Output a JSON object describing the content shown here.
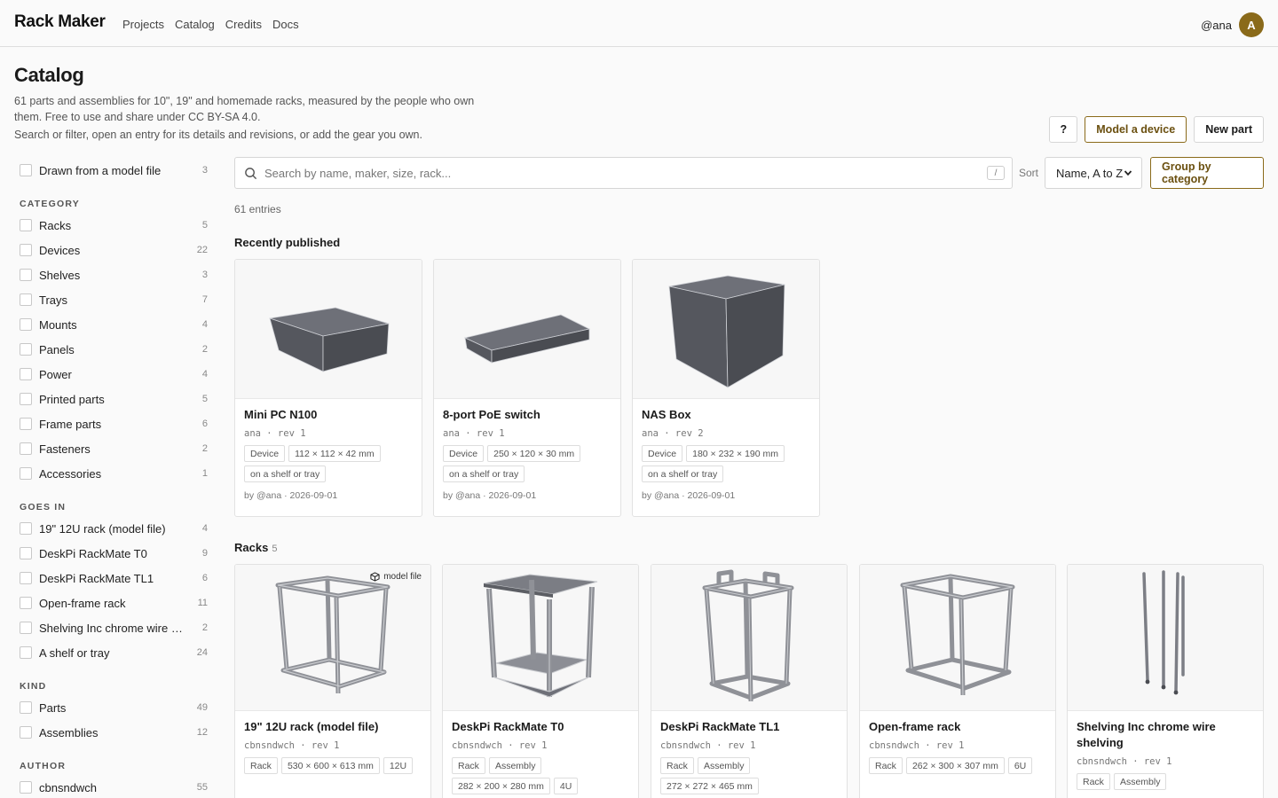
{
  "app": {
    "name": "Rack Maker",
    "nav": [
      "Projects",
      "Catalog",
      "Credits",
      "Docs"
    ],
    "user": "@ana",
    "avatar_initial": "A"
  },
  "header": {
    "title": "Catalog",
    "desc1": "61 parts and assemblies for 10\", 19\" and homemade racks, measured by the people who own them. Free to use and share under CC BY-SA 4.0.",
    "desc2": "Search or filter, open an entry for its details and revisions, or add the gear you own.",
    "help_label": "?",
    "model_device_label": "Model a device",
    "new_part_label": "New part"
  },
  "filters": {
    "model_file": {
      "label": "Drawn from a model file",
      "count": "3"
    },
    "category": {
      "heading": "CATEGORY",
      "items": [
        {
          "label": "Racks",
          "count": "5"
        },
        {
          "label": "Devices",
          "count": "22"
        },
        {
          "label": "Shelves",
          "count": "3"
        },
        {
          "label": "Trays",
          "count": "7"
        },
        {
          "label": "Mounts",
          "count": "4"
        },
        {
          "label": "Panels",
          "count": "2"
        },
        {
          "label": "Power",
          "count": "4"
        },
        {
          "label": "Printed parts",
          "count": "5"
        },
        {
          "label": "Frame parts",
          "count": "6"
        },
        {
          "label": "Fasteners",
          "count": "2"
        },
        {
          "label": "Accessories",
          "count": "1"
        }
      ]
    },
    "goes_in": {
      "heading": "GOES IN",
      "items": [
        {
          "label": "19\" 12U rack (model file)",
          "count": "4"
        },
        {
          "label": "DeskPi RackMate T0",
          "count": "9"
        },
        {
          "label": "DeskPi RackMate TL1",
          "count": "6"
        },
        {
          "label": "Open-frame rack",
          "count": "11"
        },
        {
          "label": "Shelving Inc chrome wire shelving",
          "count": "2"
        },
        {
          "label": "A shelf or tray",
          "count": "24"
        }
      ]
    },
    "kind": {
      "heading": "KIND",
      "items": [
        {
          "label": "Parts",
          "count": "49"
        },
        {
          "label": "Assemblies",
          "count": "12"
        }
      ]
    },
    "author": {
      "heading": "AUTHOR",
      "items": [
        {
          "label": "cbnsndwch",
          "count": "55"
        }
      ]
    }
  },
  "search": {
    "placeholder": "Search by name, maker, size, rack...",
    "shortcut": "/",
    "sort_label": "Sort",
    "sort_value": "Name, A to Z",
    "group_label": "Group by category",
    "entries": "61 entries"
  },
  "recent": {
    "title": "Recently published",
    "cards": [
      {
        "name": "Mini PC N100",
        "meta": "ana · rev 1",
        "tags": [
          "Device",
          "112 × 112 × 42 mm",
          "on a shelf or tray"
        ],
        "by": "by @ana · 2026-09-01"
      },
      {
        "name": "8-port PoE switch",
        "meta": "ana · rev 1",
        "tags": [
          "Device",
          "250 × 120 × 30 mm",
          "on a shelf or tray"
        ],
        "by": "by @ana · 2026-09-01"
      },
      {
        "name": "NAS Box",
        "meta": "ana · rev 2",
        "tags": [
          "Device",
          "180 × 232 × 190 mm",
          "on a shelf or tray"
        ],
        "by": "by @ana · 2026-09-01"
      }
    ]
  },
  "racks": {
    "title": "Racks",
    "count": "5",
    "model_file_badge": "model file",
    "cards": [
      {
        "name": "19\" 12U rack (model file)",
        "meta": "cbnsndwch · rev 1",
        "tags": [
          "Rack",
          "530 × 600 × 613 mm",
          "12U"
        ]
      },
      {
        "name": "DeskPi RackMate T0",
        "meta": "cbnsndwch · rev 1",
        "tags": [
          "Rack",
          "Assembly",
          "282 × 200 × 280 mm",
          "4U"
        ]
      },
      {
        "name": "DeskPi RackMate TL1",
        "meta": "cbnsndwch · rev 1",
        "tags": [
          "Rack",
          "Assembly",
          "272 × 272 × 465 mm"
        ]
      },
      {
        "name": "Open-frame rack",
        "meta": "cbnsndwch · rev 1",
        "tags": [
          "Rack",
          "262 × 300 × 307 mm",
          "6U"
        ]
      },
      {
        "name": "Shelving Inc chrome wire shelving",
        "meta": "cbnsndwch · rev 1",
        "tags": [
          "Rack",
          "Assembly"
        ]
      }
    ]
  }
}
